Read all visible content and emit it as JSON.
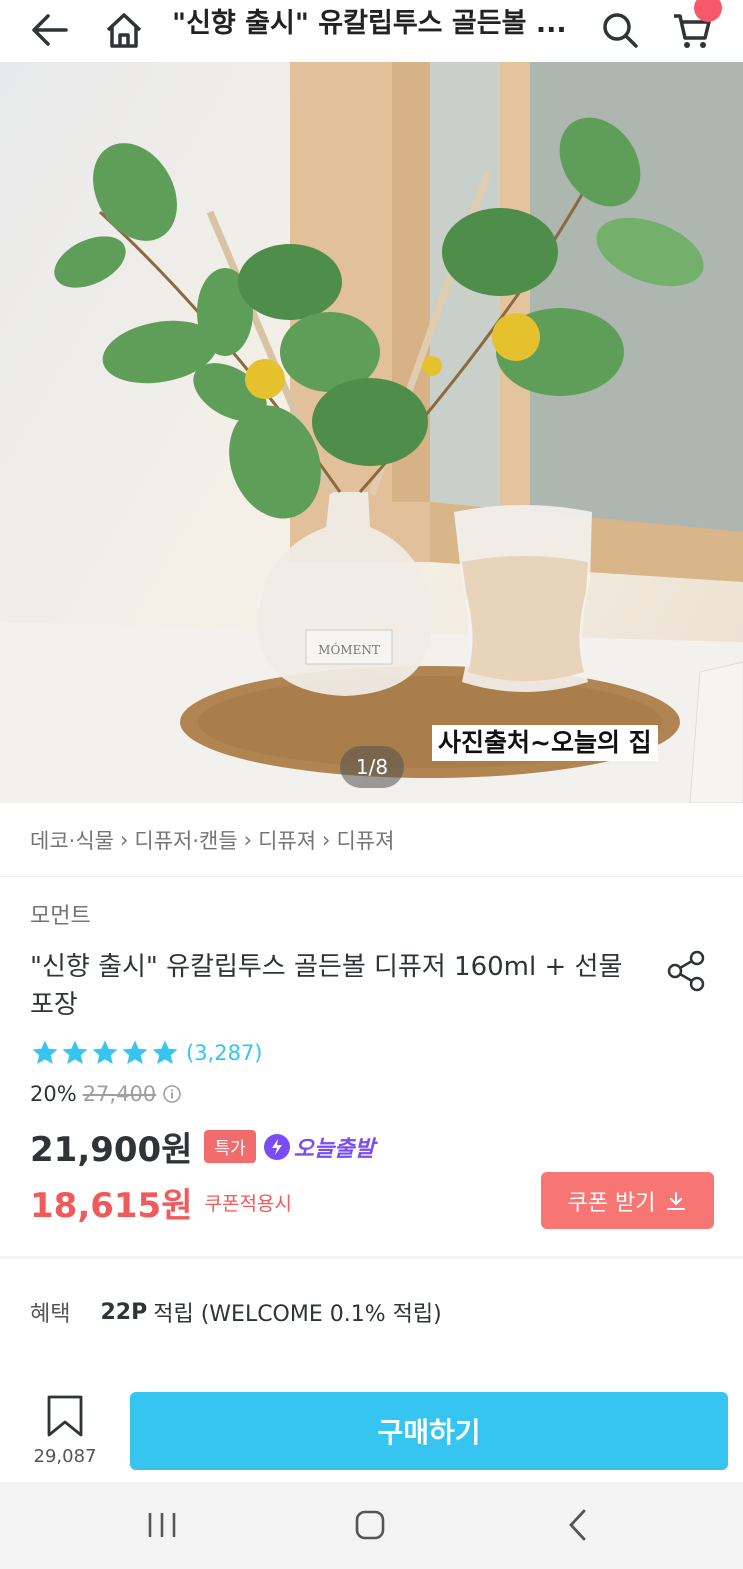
{
  "header": {
    "title": "\"신향 출시\" 유칼립투스 골든볼 ...",
    "back_icon": "arrow-left-icon",
    "home_icon": "home-icon",
    "search_icon": "search-icon",
    "cart_icon": "cart-icon"
  },
  "hero": {
    "credit": "사진출처~오늘의 집",
    "pager": "1/8",
    "label_text": "MÓMENT"
  },
  "breadcrumb": [
    "데코·식물",
    "디퓨저·캔들",
    "디퓨져",
    "디퓨져"
  ],
  "product": {
    "brand": "모먼트",
    "name": "\"신향 출시\" 유칼립투스 골든볼 디퓨저 160ml + 선물포장",
    "rating": 5,
    "review_count": "(3,287)",
    "discount_rate": "20%",
    "original_price": "27,400",
    "price": "21,900원",
    "badge": "특가",
    "shipping_badge": "오늘출발",
    "coupon_price": "18,615원",
    "coupon_applied": "쿠폰적용시",
    "coupon_button": "쿠폰 받기"
  },
  "benefit": {
    "label": "혜택",
    "points": "22P",
    "text": "적립 (WELCOME 0.1% 적립)"
  },
  "bottom": {
    "scrap_count": "29,087",
    "buy_label": "구매하기"
  },
  "colors": {
    "accent": "#35c5f0",
    "coupon": "#f05a5a",
    "shipping": "#7a4cf5"
  }
}
